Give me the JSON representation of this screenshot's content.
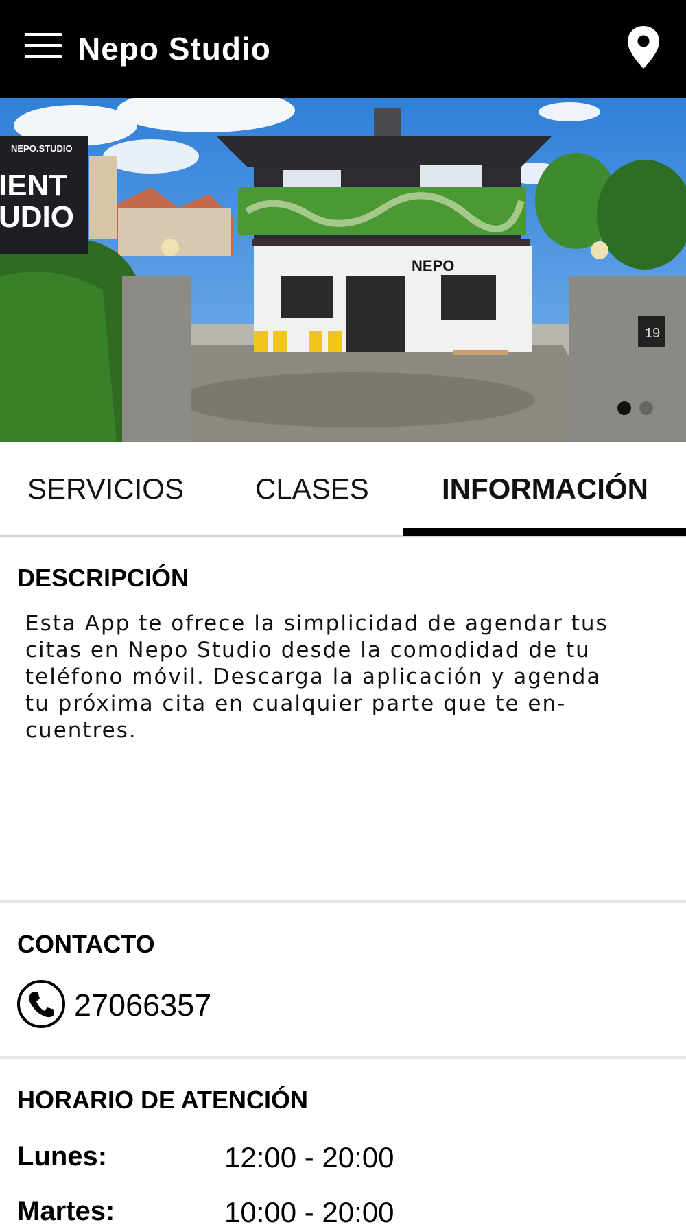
{
  "app_bar": {
    "title": "Nepo Studio",
    "menu_icon": "hamburger-menu-icon",
    "location_icon": "map-pin-icon"
  },
  "hero": {
    "sign_brand": "NEPO.STUDIO",
    "sign_line1": "IENT",
    "sign_line2": "UDIO",
    "building_sign": "NEPO",
    "house_number": "19"
  },
  "tabs": [
    {
      "label": "SERVICIOS",
      "active": false
    },
    {
      "label": "CLASES",
      "active": false
    },
    {
      "label": "INFORMACIÓN",
      "active": true
    }
  ],
  "description": {
    "title": "DESCRIPCIÓN",
    "text": "Esta App te ofrece la simplicidad de agendar tus\ncitas en Nepo Studio desde la comodidad de tu\nteléfono móvil. Descarga la aplicación y agenda\ntu próxima cita en cualquier parte que te en-\ncuentres."
  },
  "contact": {
    "title": "CONTACTO",
    "phone": "27066357",
    "icon": "phone-icon"
  },
  "schedule": {
    "title": "HORARIO DE ATENCIÓN",
    "days": [
      {
        "day": "Lunes:",
        "hours": "12:00 - 20:00"
      },
      {
        "day": "Martes:",
        "hours": "10:00 - 20:00"
      }
    ]
  },
  "colors": {
    "app_bar": "#000000",
    "accent": "#000000",
    "divider": "#e6e6e6"
  }
}
